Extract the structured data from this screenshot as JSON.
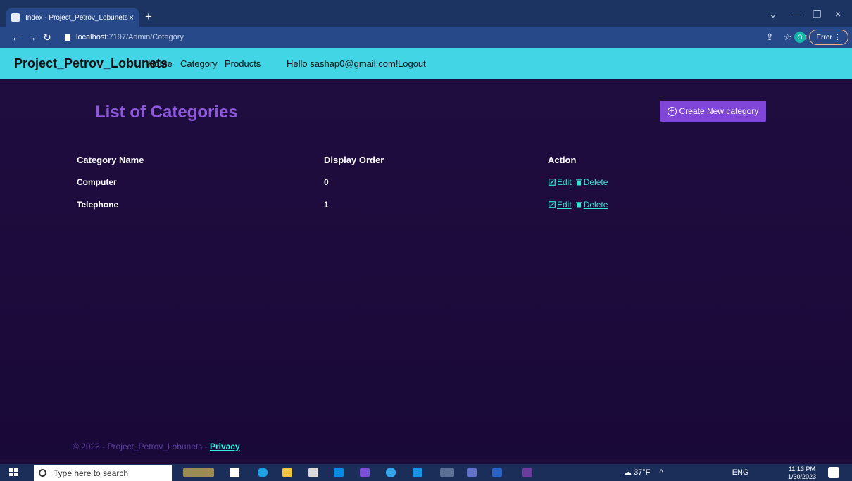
{
  "browser": {
    "tab_title": "Index - Project_Petrov_Lobunets",
    "url_host": "localhost",
    "url_path": ":7197/Admin/Category",
    "profile_letter": "O",
    "error_label": "Error"
  },
  "navbar": {
    "brand": "Project_Petrov_Lobunets",
    "links": [
      "Home",
      "Category",
      "Products"
    ],
    "hello": "Hello sashap0@gmail.com!",
    "logout": "Logout"
  },
  "page": {
    "title": "List of Categories",
    "create_button": "Create New category",
    "columns": [
      "Category Name",
      "Display Order",
      "Action"
    ],
    "rows": [
      {
        "name": "Computer",
        "order": "0",
        "edit": "Edit",
        "delete": "Delete"
      },
      {
        "name": "Telephone",
        "order": "1",
        "edit": "Edit",
        "delete": "Delete"
      }
    ]
  },
  "footer": {
    "text": "© 2023 - Project_Petrov_Lobunets - ",
    "privacy": "Privacy"
  },
  "taskbar": {
    "search_placeholder": "Type here to search",
    "weather": "37°F",
    "lang": "ENG",
    "time": "11:13 PM",
    "date": "1/30/2023"
  },
  "colors": {
    "accent": "#8045d9",
    "navbar": "#42d5e6",
    "link": "#33e6d2",
    "background": "#1e0c3a"
  }
}
